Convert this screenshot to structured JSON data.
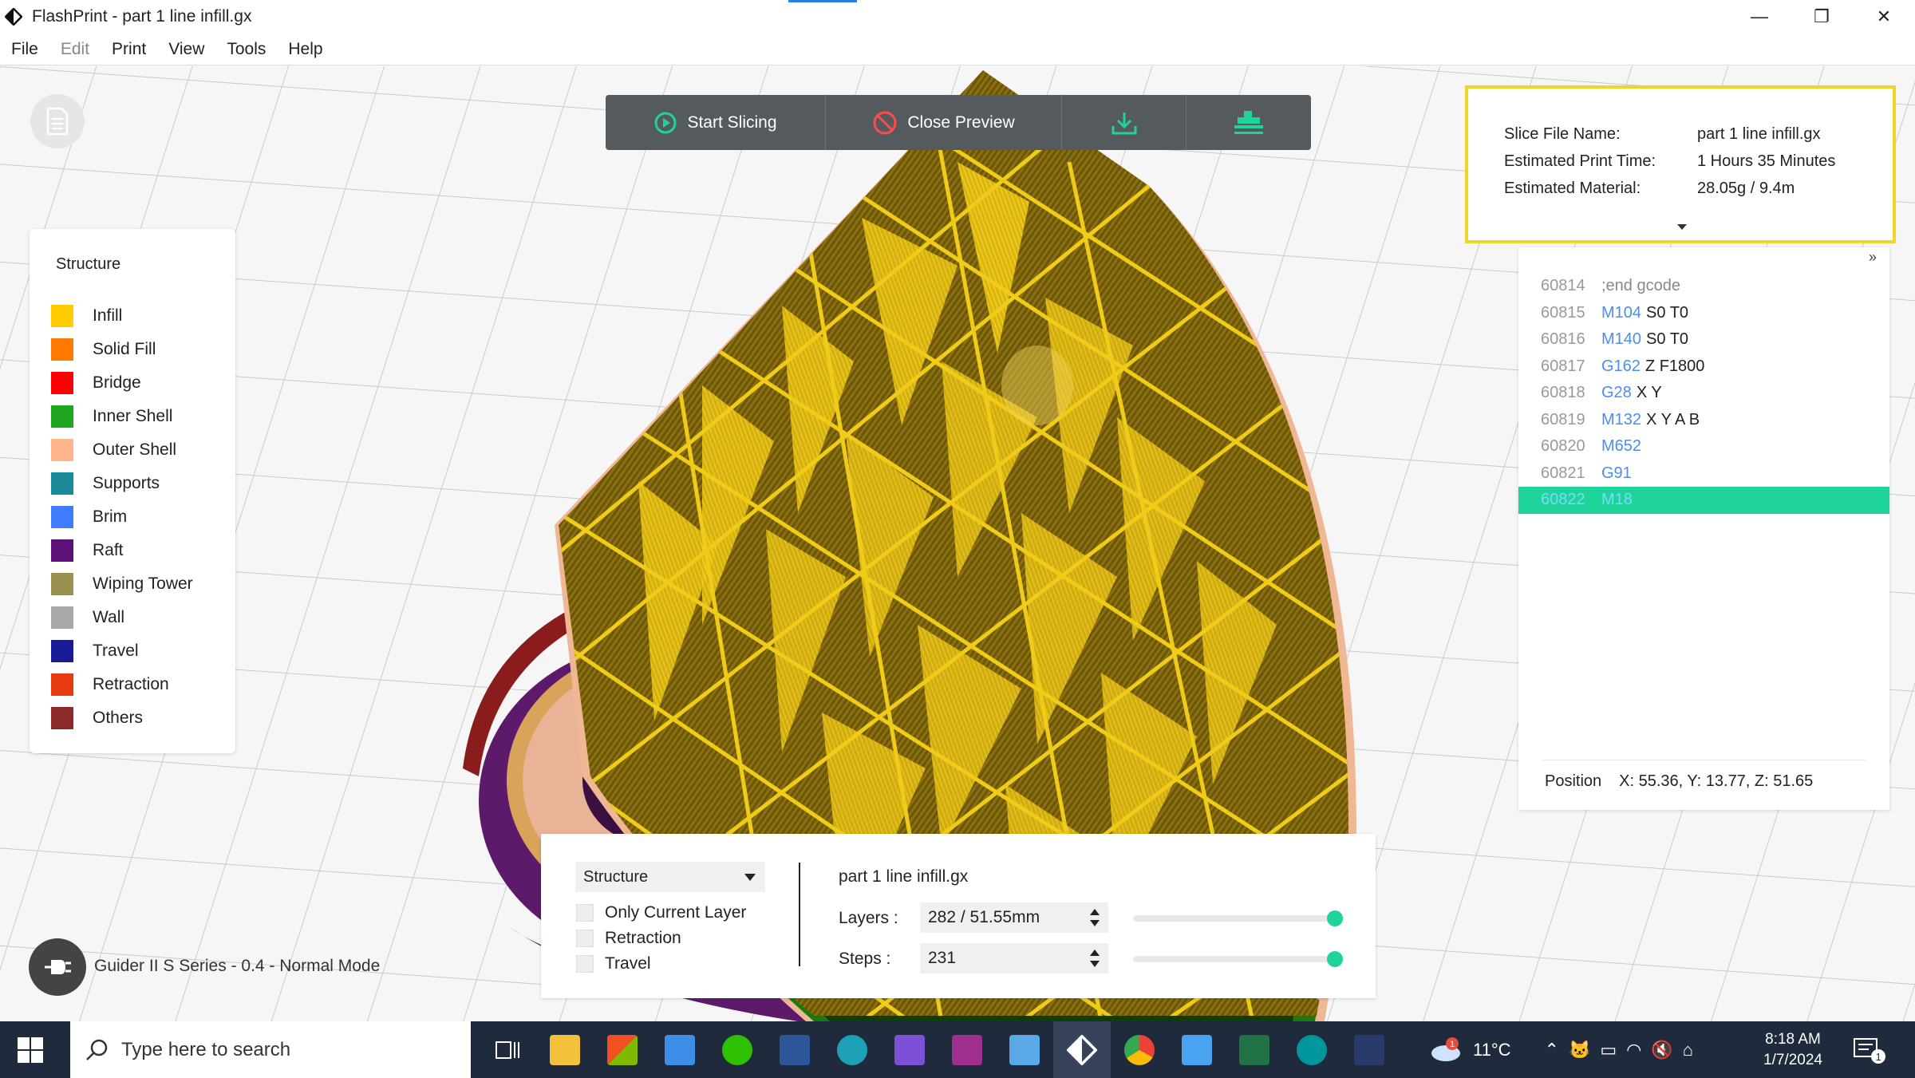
{
  "window": {
    "title": "FlashPrint - part 1 line infill.gx",
    "minimize": "—",
    "maximize": "❐",
    "close": "✕"
  },
  "menu": [
    "File",
    "Edit",
    "Print",
    "View",
    "Tools",
    "Help"
  ],
  "toolbar": {
    "start_slicing": "Start Slicing",
    "close_preview": "Close Preview"
  },
  "legend": {
    "title": "Structure",
    "items": [
      {
        "label": "Infill",
        "color": "#ffcc00"
      },
      {
        "label": "Solid Fill",
        "color": "#ff7a00"
      },
      {
        "label": "Bridge",
        "color": "#ff0000"
      },
      {
        "label": "Inner Shell",
        "color": "#1fa51f"
      },
      {
        "label": "Outer Shell",
        "color": "#ffb48c"
      },
      {
        "label": "Supports",
        "color": "#1a8a99"
      },
      {
        "label": "Brim",
        "color": "#3f7cff"
      },
      {
        "label": "Raft",
        "color": "#5c1078"
      },
      {
        "label": "Wiping Tower",
        "color": "#9a9050"
      },
      {
        "label": "Wall",
        "color": "#a8a8a8"
      },
      {
        "label": "Travel",
        "color": "#1a1a99"
      },
      {
        "label": "Retraction",
        "color": "#e83a10"
      },
      {
        "label": "Others",
        "color": "#8c2a2a"
      }
    ]
  },
  "info": {
    "slice_file_label": "Slice File Name:",
    "slice_file_value": "part 1 line infill.gx",
    "time_label": "Estimated Print Time:",
    "time_value": "1 Hours 35 Minutes",
    "material_label": "Estimated Material:",
    "material_value": "28.05g / 9.4m"
  },
  "gcode": {
    "collapse": "»",
    "lines": [
      {
        "num": "60814",
        "cmd": "",
        "rest": ";end gcode",
        "comment": true
      },
      {
        "num": "60815",
        "cmd": "M104",
        "rest": "S0 T0"
      },
      {
        "num": "60816",
        "cmd": "M140",
        "rest": "S0 T0"
      },
      {
        "num": "60817",
        "cmd": "G162",
        "rest": "Z F1800"
      },
      {
        "num": "60818",
        "cmd": "G28",
        "rest": "X Y"
      },
      {
        "num": "60819",
        "cmd": "M132",
        "rest": "X Y A B"
      },
      {
        "num": "60820",
        "cmd": "M652",
        "rest": ""
      },
      {
        "num": "60821",
        "cmd": "G91",
        "rest": ""
      },
      {
        "num": "60822",
        "cmd": "M18",
        "rest": "",
        "selected": true
      }
    ],
    "position_label": "Position",
    "position_value": "X: 55.36, Y: 13.77, Z: 51.65"
  },
  "controls": {
    "view_mode": "Structure",
    "only_current_layer": "Only Current Layer",
    "retraction": "Retraction",
    "travel": "Travel",
    "file_name": "part 1 line infill.gx",
    "layers_label": "Layers :",
    "layers_value": "282 / 51.55mm",
    "steps_label": "Steps :",
    "steps_value": "231",
    "layers_slider_fraction": 1.0,
    "steps_slider_fraction": 1.0
  },
  "machine": {
    "label": "Guider II S Series - 0.4 - Normal Mode"
  },
  "taskbar": {
    "search_placeholder": "Type here to search",
    "weather": "11°C",
    "time": "8:18 AM",
    "date": "1/7/2024",
    "weather_badge": "1",
    "notification_count": "1"
  }
}
